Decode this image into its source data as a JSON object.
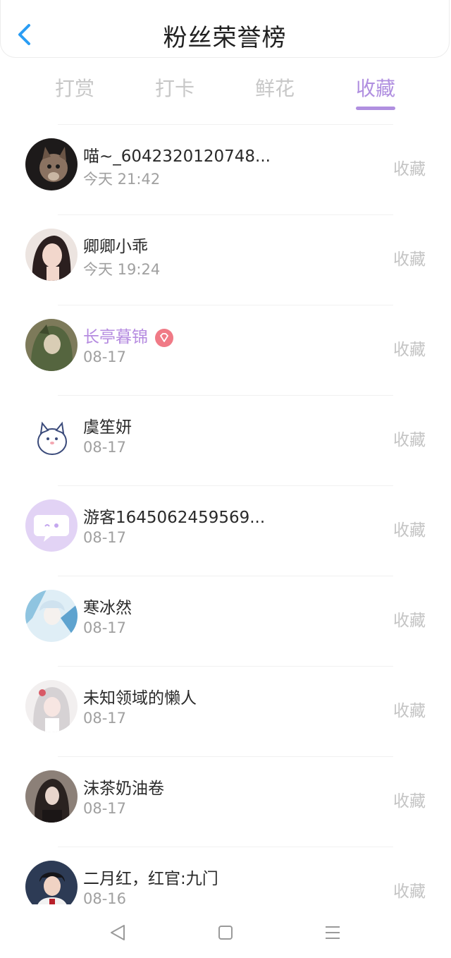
{
  "header": {
    "title": "粉丝荣誉榜"
  },
  "tabs": [
    {
      "label": "打赏",
      "active": false
    },
    {
      "label": "打卡",
      "active": false
    },
    {
      "label": "鲜花",
      "active": false
    },
    {
      "label": "收藏",
      "active": true
    }
  ],
  "accent_color": "#b08fe0",
  "list": [
    {
      "name": "喵~_6042320120748...",
      "time": "今天 21:42",
      "action": "收藏"
    },
    {
      "name": "卿卿小乖",
      "time": "今天 19:24",
      "action": "收藏"
    },
    {
      "name": "长亭暮锦",
      "time": "08-17",
      "action": "收藏",
      "vip": true,
      "badge_icon": "diamond-icon"
    },
    {
      "name": "虞笙妍",
      "time": "08-17",
      "action": "收藏"
    },
    {
      "name": "游客1645062459569...",
      "time": "08-17",
      "action": "收藏"
    },
    {
      "name": "寒冰然",
      "time": "08-17",
      "action": "收藏"
    },
    {
      "name": "未知领域的懒人",
      "time": "08-17",
      "action": "收藏"
    },
    {
      "name": "沫茶奶油卷",
      "time": "08-17",
      "action": "收藏"
    },
    {
      "name": "二月红，红官:九门",
      "time": "08-16",
      "action": "收藏"
    }
  ],
  "navbar": {
    "icons": [
      "back-triangle-icon",
      "home-square-icon",
      "menu-lines-icon"
    ]
  }
}
